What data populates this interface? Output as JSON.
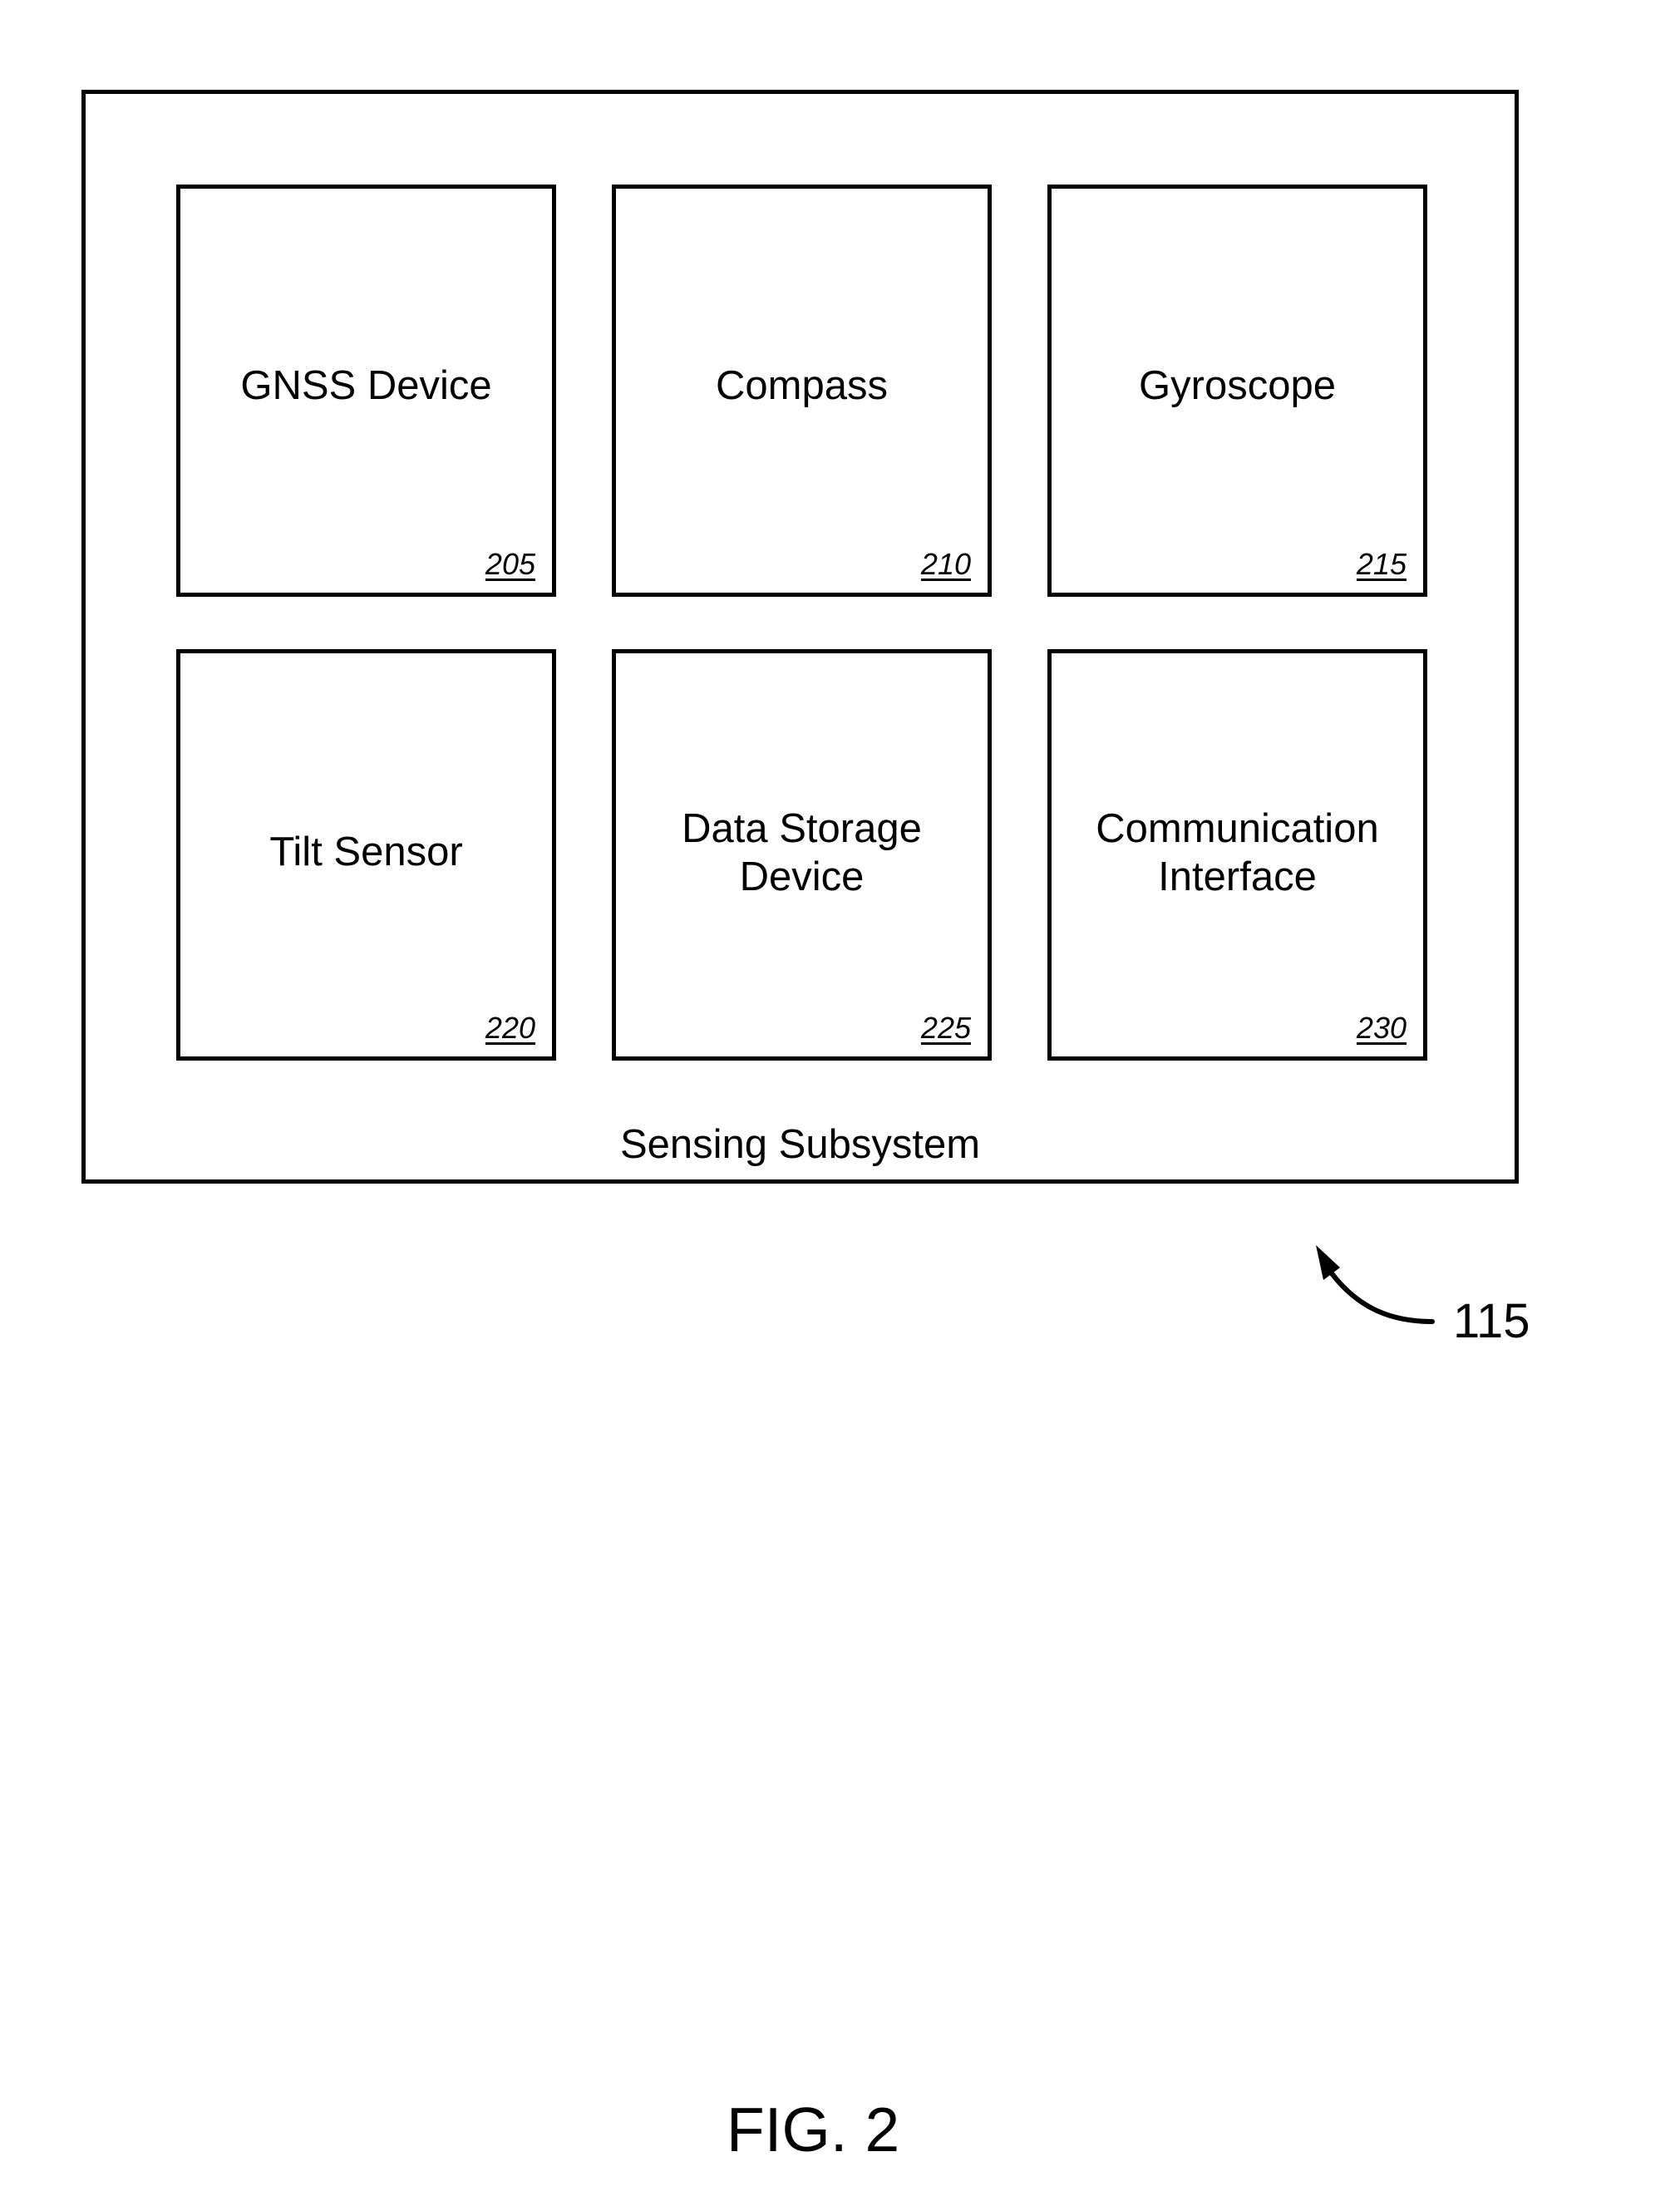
{
  "diagram": {
    "container": {
      "label": "Sensing Subsystem",
      "reference": "115"
    },
    "blocks": [
      {
        "label": "GNSS Device",
        "ref": "205"
      },
      {
        "label": "Compass",
        "ref": "210"
      },
      {
        "label": "Gyroscope",
        "ref": "215"
      },
      {
        "label": "Tilt Sensor",
        "ref": "220"
      },
      {
        "label": "Data Storage\nDevice",
        "ref": "225"
      },
      {
        "label": "Communication\nInterface",
        "ref": "230"
      }
    ],
    "callout_icon": "curved-arrow-icon",
    "figure_label": "FIG. 2"
  }
}
